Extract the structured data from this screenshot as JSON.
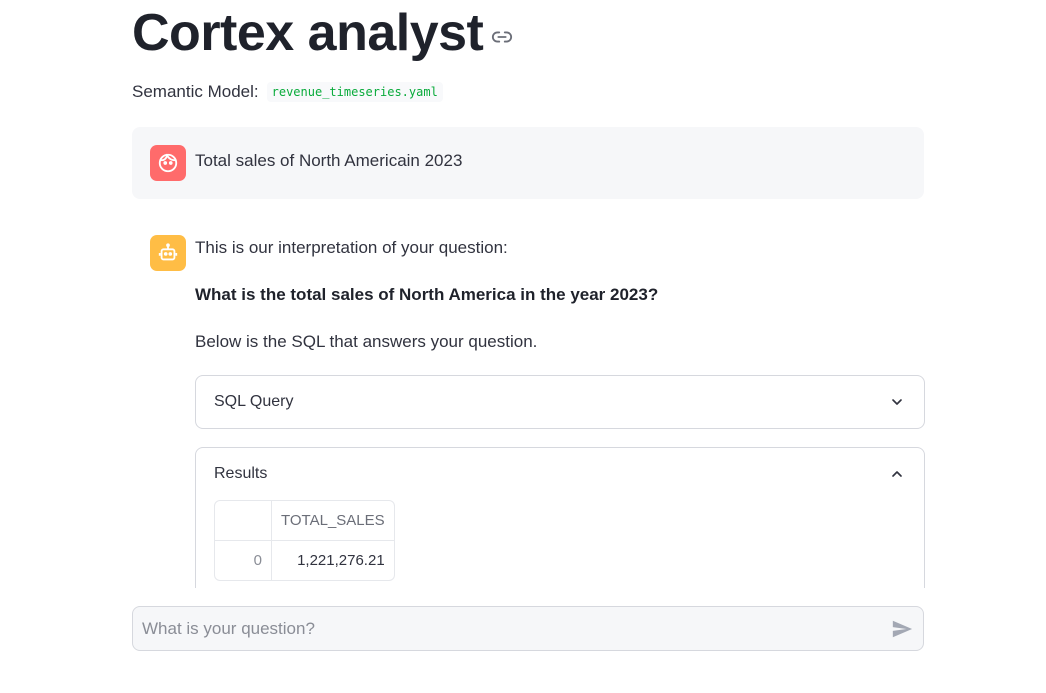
{
  "header": {
    "title": "Cortex analyst",
    "link_icon": "link-icon"
  },
  "semantic_model": {
    "label": "Semantic Model:",
    "file": "revenue_timeseries.yaml"
  },
  "conversation": {
    "user_message": {
      "avatar_icon": "user-face-icon",
      "avatar_color": "#ff6b6b",
      "text": "Total sales of North Americain 2023"
    },
    "assistant_message": {
      "avatar_icon": "robot-icon",
      "avatar_color": "#ffbd45",
      "intro": "This is our interpretation of your question:",
      "interpretation": "What is the total sales of North America in the year 2023?",
      "sql_intro": "Below is the SQL that answers your question.",
      "sql_expander": {
        "label": "SQL Query",
        "state": "collapsed",
        "icon": "chevron-down-icon"
      },
      "results_expander": {
        "label": "Results",
        "state": "expanded",
        "icon": "chevron-up-icon",
        "table": {
          "columns": [
            "",
            "TOTAL_SALES"
          ],
          "rows": [
            {
              "index": "0",
              "total_sales": "1,221,276.21"
            }
          ]
        }
      }
    }
  },
  "chat_input": {
    "placeholder": "What is your question?",
    "value": "",
    "send_icon": "send-icon"
  }
}
